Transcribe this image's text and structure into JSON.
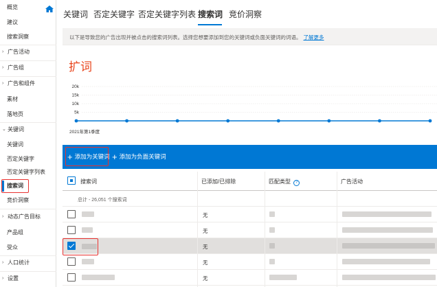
{
  "sidebar": {
    "items": [
      {
        "label": "概览",
        "group": false
      },
      {
        "label": "建议",
        "group": false
      },
      {
        "label": "搜索洞察",
        "group": false
      },
      {
        "label": "广告活动",
        "group": true
      },
      {
        "label": "广告组",
        "group": true
      },
      {
        "label": "广告和组件",
        "group": true
      },
      {
        "label": "素材",
        "group": false
      },
      {
        "label": "落地页",
        "group": false
      },
      {
        "label": "关键词",
        "group": true,
        "expanded": true
      },
      {
        "label": "关键词",
        "group": false
      },
      {
        "label": "否定关键字",
        "group": false
      },
      {
        "label": "否定关键字列表",
        "group": false
      },
      {
        "label": "搜索词",
        "group": false,
        "active": true
      },
      {
        "label": "竞价洞察",
        "group": false
      },
      {
        "label": "动态广告目标",
        "group": true
      },
      {
        "label": "产品组",
        "group": false
      },
      {
        "label": "受众",
        "group": false
      },
      {
        "label": "人口统计",
        "group": true
      },
      {
        "label": "设置",
        "group": true
      }
    ]
  },
  "tabs": [
    {
      "label": "关键词",
      "active": false
    },
    {
      "label": "否定关键字",
      "active": false
    },
    {
      "label": "否定关键字列表",
      "active": false
    },
    {
      "label": "搜索词",
      "active": true
    },
    {
      "label": "竞价洞察",
      "active": false
    }
  ],
  "info_bar": {
    "text": "以下是导致您的广告出现并被点击的搜索词列表。选择您想要添加到您的关键词或负面关键词的词语。",
    "link": "了解更多"
  },
  "section_title": "扩词",
  "chart_data": {
    "type": "line",
    "y_ticks": [
      "20k",
      "15k",
      "10k",
      "5k"
    ],
    "ylim": [
      0,
      20000
    ],
    "x_label": "2021年第1季度",
    "series": [
      {
        "values": [
          0,
          0,
          0,
          0,
          0,
          0,
          0,
          0
        ]
      }
    ],
    "color": "#0078d4",
    "grid": true
  },
  "toolbar": {
    "add_keyword": "添加为关键词",
    "add_negative": "添加为负面关键词"
  },
  "table": {
    "columns": [
      "搜索词",
      "已添加/已排除",
      "匹配类型",
      "广告活动"
    ],
    "summary": "总计 - 26,051 个搜索词",
    "rows": [
      {
        "added": "无",
        "checked": false
      },
      {
        "added": "无",
        "checked": false
      },
      {
        "added": "无",
        "checked": true
      },
      {
        "added": "无",
        "checked": false
      },
      {
        "added": "无",
        "checked": false
      }
    ]
  },
  "colors": {
    "accent": "#0078d4",
    "highlight_box": "#e8312f",
    "title": "#e8431a"
  },
  "icons": [
    "home-icon",
    "chevron-right-icon",
    "chevron-down-icon",
    "plus-icon",
    "help-icon",
    "checkbox-icon"
  ]
}
